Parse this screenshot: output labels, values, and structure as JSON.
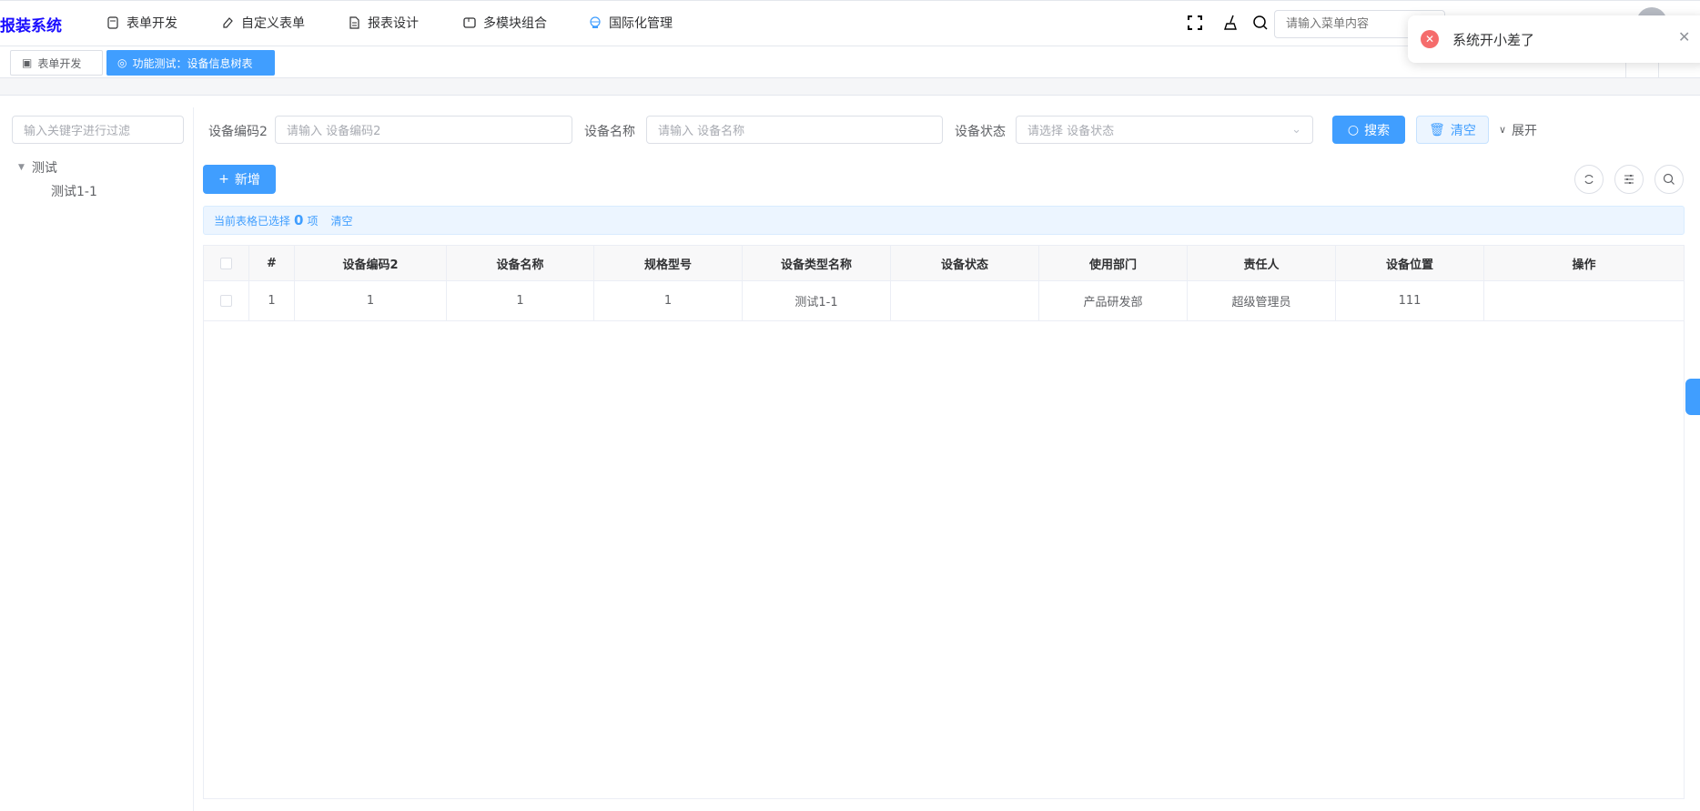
{
  "header": {
    "logo": "报装系统",
    "nav": [
      {
        "label": "表单开发",
        "icon": "form-icon"
      },
      {
        "label": "自定义表单",
        "icon": "edit-icon"
      },
      {
        "label": "报表设计",
        "icon": "document-icon"
      },
      {
        "label": "多模块组合",
        "icon": "module-icon"
      },
      {
        "label": "国际化管理",
        "icon": "globe-icon"
      }
    ],
    "menu_search_placeholder": "请输入菜单内容"
  },
  "toast": {
    "message": "系统开小差了",
    "type": "error"
  },
  "tabs": [
    {
      "label": "表单开发",
      "active": false
    },
    {
      "label": "功能测试：设备信息树表",
      "active": true
    }
  ],
  "tree": {
    "filter_placeholder": "输入关键字进行过滤",
    "nodes": [
      {
        "label": "测试",
        "children": [
          {
            "label": "测试1-1"
          }
        ]
      }
    ]
  },
  "search": {
    "fields": [
      {
        "label": "设备编码2",
        "placeholder": "请输入 设备编码2"
      },
      {
        "label": "设备名称",
        "placeholder": "请输入 设备名称"
      },
      {
        "label": "设备状态",
        "placeholder": "请选择 设备状态"
      }
    ],
    "search_label": "搜索",
    "clear_label": "清空",
    "expand_label": "展开"
  },
  "toolbar": {
    "add_label": "新增"
  },
  "selection": {
    "prefix": "当前表格已选择",
    "count": "0",
    "suffix": "项",
    "clear": "清空"
  },
  "table": {
    "columns": [
      "#",
      "设备编码2",
      "设备名称",
      "规格型号",
      "设备类型名称",
      "设备状态",
      "使用部门",
      "责任人",
      "设备位置",
      "操作"
    ],
    "rows": [
      [
        "1",
        "1",
        "1",
        "1",
        "测试1-1",
        "",
        "产品研发部",
        "超级管理员",
        "111",
        ""
      ]
    ]
  },
  "colors": {
    "primary": "#409eff",
    "error": "#f56c6c",
    "logo": "#1a0dff"
  }
}
